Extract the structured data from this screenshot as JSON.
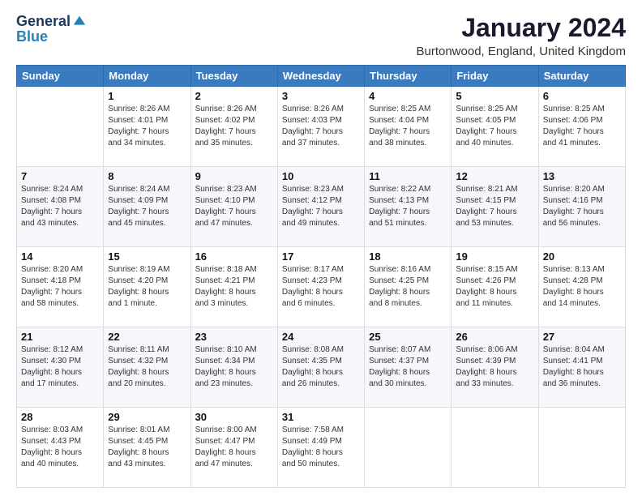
{
  "header": {
    "logo": {
      "general": "General",
      "blue": "Blue",
      "tagline": ""
    },
    "title": "January 2024",
    "location": "Burtonwood, England, United Kingdom"
  },
  "days_of_week": [
    "Sunday",
    "Monday",
    "Tuesday",
    "Wednesday",
    "Thursday",
    "Friday",
    "Saturday"
  ],
  "weeks": [
    [
      {
        "day": "",
        "info": ""
      },
      {
        "day": "1",
        "info": "Sunrise: 8:26 AM\nSunset: 4:01 PM\nDaylight: 7 hours\nand 34 minutes."
      },
      {
        "day": "2",
        "info": "Sunrise: 8:26 AM\nSunset: 4:02 PM\nDaylight: 7 hours\nand 35 minutes."
      },
      {
        "day": "3",
        "info": "Sunrise: 8:26 AM\nSunset: 4:03 PM\nDaylight: 7 hours\nand 37 minutes."
      },
      {
        "day": "4",
        "info": "Sunrise: 8:25 AM\nSunset: 4:04 PM\nDaylight: 7 hours\nand 38 minutes."
      },
      {
        "day": "5",
        "info": "Sunrise: 8:25 AM\nSunset: 4:05 PM\nDaylight: 7 hours\nand 40 minutes."
      },
      {
        "day": "6",
        "info": "Sunrise: 8:25 AM\nSunset: 4:06 PM\nDaylight: 7 hours\nand 41 minutes."
      }
    ],
    [
      {
        "day": "7",
        "info": "Sunrise: 8:24 AM\nSunset: 4:08 PM\nDaylight: 7 hours\nand 43 minutes."
      },
      {
        "day": "8",
        "info": "Sunrise: 8:24 AM\nSunset: 4:09 PM\nDaylight: 7 hours\nand 45 minutes."
      },
      {
        "day": "9",
        "info": "Sunrise: 8:23 AM\nSunset: 4:10 PM\nDaylight: 7 hours\nand 47 minutes."
      },
      {
        "day": "10",
        "info": "Sunrise: 8:23 AM\nSunset: 4:12 PM\nDaylight: 7 hours\nand 49 minutes."
      },
      {
        "day": "11",
        "info": "Sunrise: 8:22 AM\nSunset: 4:13 PM\nDaylight: 7 hours\nand 51 minutes."
      },
      {
        "day": "12",
        "info": "Sunrise: 8:21 AM\nSunset: 4:15 PM\nDaylight: 7 hours\nand 53 minutes."
      },
      {
        "day": "13",
        "info": "Sunrise: 8:20 AM\nSunset: 4:16 PM\nDaylight: 7 hours\nand 56 minutes."
      }
    ],
    [
      {
        "day": "14",
        "info": "Sunrise: 8:20 AM\nSunset: 4:18 PM\nDaylight: 7 hours\nand 58 minutes."
      },
      {
        "day": "15",
        "info": "Sunrise: 8:19 AM\nSunset: 4:20 PM\nDaylight: 8 hours\nand 1 minute."
      },
      {
        "day": "16",
        "info": "Sunrise: 8:18 AM\nSunset: 4:21 PM\nDaylight: 8 hours\nand 3 minutes."
      },
      {
        "day": "17",
        "info": "Sunrise: 8:17 AM\nSunset: 4:23 PM\nDaylight: 8 hours\nand 6 minutes."
      },
      {
        "day": "18",
        "info": "Sunrise: 8:16 AM\nSunset: 4:25 PM\nDaylight: 8 hours\nand 8 minutes."
      },
      {
        "day": "19",
        "info": "Sunrise: 8:15 AM\nSunset: 4:26 PM\nDaylight: 8 hours\nand 11 minutes."
      },
      {
        "day": "20",
        "info": "Sunrise: 8:13 AM\nSunset: 4:28 PM\nDaylight: 8 hours\nand 14 minutes."
      }
    ],
    [
      {
        "day": "21",
        "info": "Sunrise: 8:12 AM\nSunset: 4:30 PM\nDaylight: 8 hours\nand 17 minutes."
      },
      {
        "day": "22",
        "info": "Sunrise: 8:11 AM\nSunset: 4:32 PM\nDaylight: 8 hours\nand 20 minutes."
      },
      {
        "day": "23",
        "info": "Sunrise: 8:10 AM\nSunset: 4:34 PM\nDaylight: 8 hours\nand 23 minutes."
      },
      {
        "day": "24",
        "info": "Sunrise: 8:08 AM\nSunset: 4:35 PM\nDaylight: 8 hours\nand 26 minutes."
      },
      {
        "day": "25",
        "info": "Sunrise: 8:07 AM\nSunset: 4:37 PM\nDaylight: 8 hours\nand 30 minutes."
      },
      {
        "day": "26",
        "info": "Sunrise: 8:06 AM\nSunset: 4:39 PM\nDaylight: 8 hours\nand 33 minutes."
      },
      {
        "day": "27",
        "info": "Sunrise: 8:04 AM\nSunset: 4:41 PM\nDaylight: 8 hours\nand 36 minutes."
      }
    ],
    [
      {
        "day": "28",
        "info": "Sunrise: 8:03 AM\nSunset: 4:43 PM\nDaylight: 8 hours\nand 40 minutes."
      },
      {
        "day": "29",
        "info": "Sunrise: 8:01 AM\nSunset: 4:45 PM\nDaylight: 8 hours\nand 43 minutes."
      },
      {
        "day": "30",
        "info": "Sunrise: 8:00 AM\nSunset: 4:47 PM\nDaylight: 8 hours\nand 47 minutes."
      },
      {
        "day": "31",
        "info": "Sunrise: 7:58 AM\nSunset: 4:49 PM\nDaylight: 8 hours\nand 50 minutes."
      },
      {
        "day": "",
        "info": ""
      },
      {
        "day": "",
        "info": ""
      },
      {
        "day": "",
        "info": ""
      }
    ]
  ]
}
